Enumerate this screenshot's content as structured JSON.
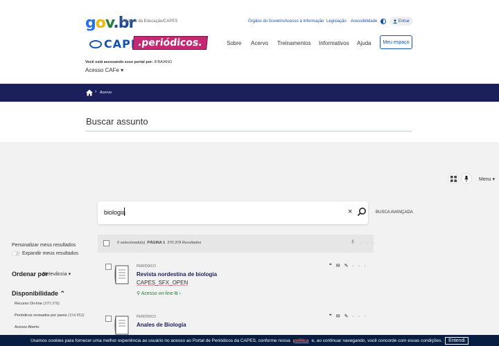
{
  "header": {
    "gov_logo": {
      "g": "g",
      "o": "o",
      "v": "v",
      "br": ".br"
    },
    "ministry": "Ministério da Educação/CAPES",
    "topnav": [
      "Órgãos do Governo",
      "Acesso à Informação",
      "Legislação",
      "Acessibilidade"
    ],
    "entrar": "Entrar",
    "capes": "CAPES",
    "periodicos": ".periódicos.",
    "mainnav": [
      "Sobre",
      "Acervo",
      "Treinamentos",
      "Informativos",
      "Ajuda"
    ],
    "meu_espaco": "Meu espaço",
    "access_prefix": "Você está acessando esse portal por:",
    "access_institution": "IFBAIANO",
    "acesso_cafe": "Acesso CAFe ▾"
  },
  "breadcrumb": {
    "sep": "›",
    "current": "Acervo"
  },
  "page_title": "Buscar assunto",
  "toolbar": {
    "menu": "Menu ▾"
  },
  "search": {
    "value": "biologia",
    "clear": "×",
    "advanced": "BUSCA AVANÇADA"
  },
  "sidebar": {
    "personalize": "Personalizar meus resultados",
    "expand": "Expandir meus resultados",
    "order_label": "Ordenar por",
    "order_value": "Relevância ▾",
    "availability": "Disponibilidade ⌃",
    "facets": [
      {
        "label": "Recurso On-line",
        "count": "(370.378)"
      },
      {
        "label": "Periódicos revisados por pares",
        "count": "(154.852)"
      },
      {
        "label": "Acesso Aberto",
        "count": ""
      }
    ]
  },
  "results": {
    "selected": "0 selecionado(s)",
    "page": "PÁGINA 1",
    "count": "370.378 Resultados",
    "items": [
      {
        "type": "PERIÓDICO",
        "title": "Revista nordestina de biologia",
        "source": "CAPES_SFX_OPEN",
        "online": "Acesso on-line ⧉ ›"
      },
      {
        "type": "PERIÓDICO",
        "title": "Anales de Biología",
        "source": "",
        "online": ""
      }
    ]
  },
  "cookie": {
    "text_before": "Usamos cookies para fornecer uma melhor experiência ao usuário no acesso ao Portal de Periódicos da CAPES, conforme nossa",
    "link": "política",
    "text_after": "e, ao continuar navegando, você concorde com essas condições.",
    "button": "Entendi"
  }
}
